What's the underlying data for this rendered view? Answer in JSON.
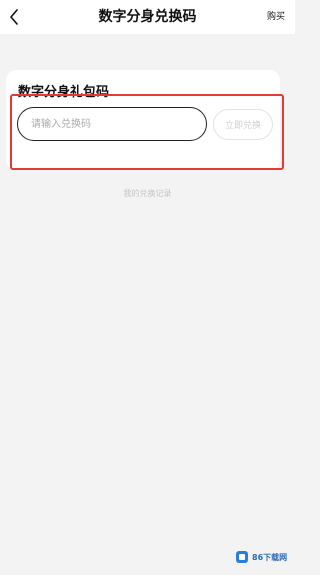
{
  "header": {
    "title": "数字分身兑换码",
    "action_label": "购买"
  },
  "card": {
    "title": "数字分身礼包码"
  },
  "form": {
    "input_placeholder": "请输入兑换码",
    "input_value": "",
    "redeem_label": "立即兑换"
  },
  "footer": {
    "history_label": "我的兑换记录"
  },
  "watermark": {
    "text": "86下载网"
  },
  "colors": {
    "highlight_border": "#e53935",
    "page_background": "#f3f3f4",
    "disabled_text": "#cfcfcf"
  },
  "icons": {
    "back": "chevron-left-icon"
  }
}
